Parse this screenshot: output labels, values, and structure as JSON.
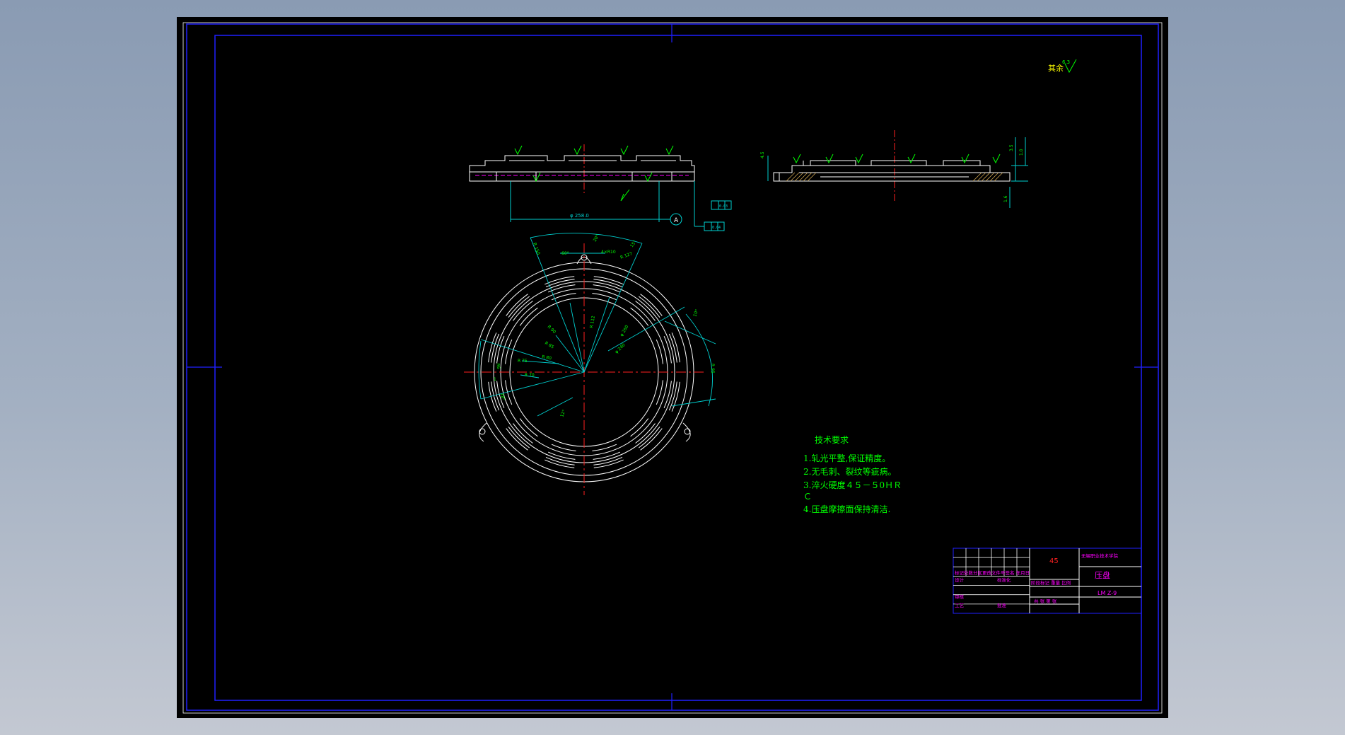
{
  "drawing": {
    "rough_note": "其余",
    "rough_value": "6.3",
    "tech_req": {
      "title": "技术要求",
      "items": [
        "1.轧光平整,保证精度。",
        "2.无毛刺、裂纹等疵病。",
        "3.淬火硬度４５－５0ＨＲ",
        "Ｃ",
        "4.压盘摩擦面保持清洁."
      ]
    },
    "title_block": {
      "material": "45",
      "school": "无锡职业技术学院",
      "part_name": "压盘",
      "drawing_no": "LM Z-9",
      "label_row1": "标记处数分区更改文件号签名 年月日",
      "label_design": "设计",
      "label_std": "标准化",
      "label_stage": "阶段标记 重量 比例",
      "label_review": "审核",
      "label_process": "工艺",
      "label_approve": "批准",
      "label_sheets": "共 张 第 张"
    },
    "dims": {
      "front_len": "φ 258.0",
      "datum": "A",
      "tol1": "0.03",
      "tol2": "0.04",
      "right_h1": "4.5",
      "right_h2": "3.5",
      "right_h3": "1.0",
      "right_h4": "1.6",
      "ang_a": "60°",
      "ang_b": "20°",
      "ang_c": "15°",
      "circ_r1": "R 150",
      "circ_r2": "R 127",
      "circ_r3": "R 112",
      "circ_r4": "φ 260",
      "circ_r5": "φ 240",
      "circ_r6": "R 95",
      "circ_r7": "R 90",
      "circ_r8": "R 85",
      "circ_r9": "R 80",
      "circ_r10": "R 75",
      "circ_r11": "R 70",
      "circ_d1": "4×R10",
      "circ_d2": "R6",
      "circ_d3": "1",
      "circ_ang2": "10°",
      "circ_ang3": "18°",
      "circ_ang4": "12°"
    }
  },
  "colors": {
    "frame": "#2020ff",
    "outline": "#ffffff",
    "center": "#ff2020",
    "dim": "#00d0d0",
    "text_green": "#00ff00",
    "magenta": "#ff00ff",
    "yellow": "#ffff00",
    "hatch": "#c8a050"
  }
}
